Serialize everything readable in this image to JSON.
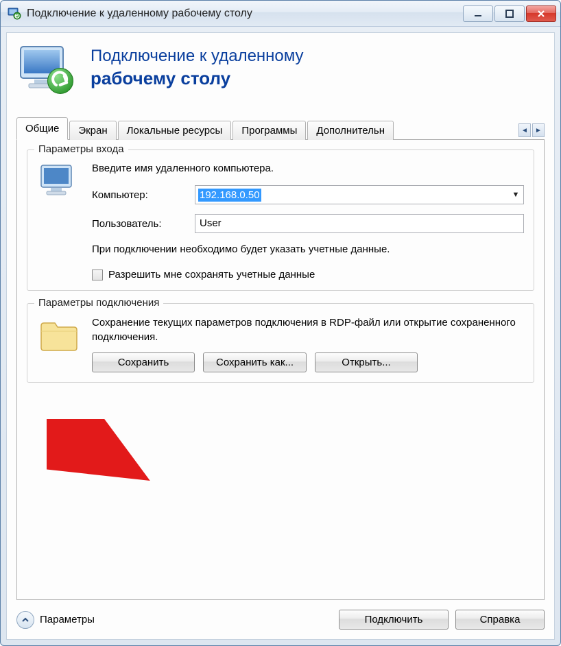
{
  "window": {
    "title": "Подключение к удаленному рабочему столу"
  },
  "header": {
    "line1": "Подключение к удаленному",
    "line2": "рабочему столу"
  },
  "tabs": [
    {
      "label": "Общие"
    },
    {
      "label": "Экран"
    },
    {
      "label": "Локальные ресурсы"
    },
    {
      "label": "Программы"
    },
    {
      "label": "Дополнительн"
    }
  ],
  "login_group": {
    "title": "Параметры входа",
    "instruction": "Введите имя удаленного компьютера.",
    "computer_label": "Компьютер:",
    "computer_value": "192.168.0.50",
    "user_label": "Пользователь:",
    "user_value": "User",
    "note": "При подключении необходимо будет указать учетные данные.",
    "checkbox_label": "Разрешить мне сохранять учетные данные"
  },
  "conn_group": {
    "title": "Параметры подключения",
    "description": "Сохранение текущих параметров подключения в RDP-файл или открытие сохраненного подключения.",
    "save": "Сохранить",
    "save_as": "Сохранить как...",
    "open": "Открыть..."
  },
  "footer": {
    "options": "Параметры",
    "connect": "Подключить",
    "help": "Справка"
  }
}
